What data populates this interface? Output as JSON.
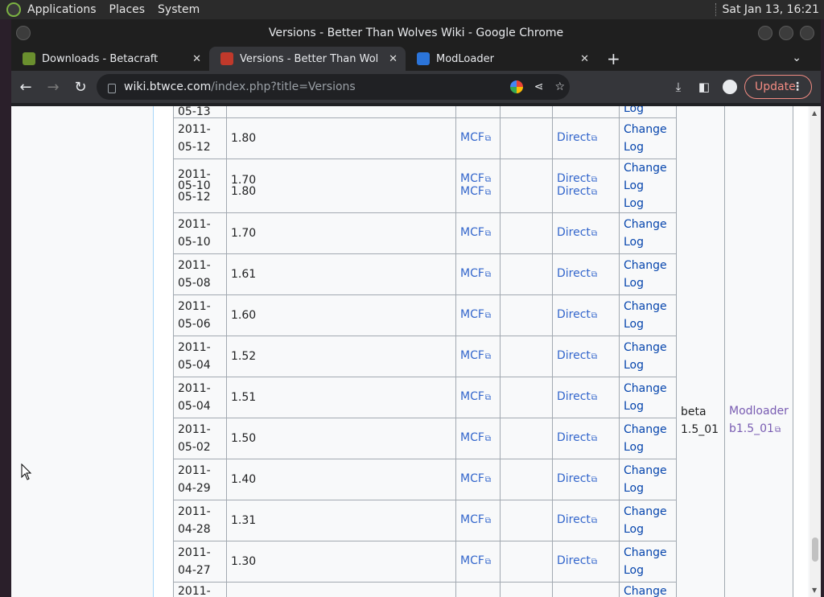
{
  "system_panel": {
    "menu": [
      "Applications",
      "Places",
      "System"
    ],
    "clock": "Sat Jan 13, 16:21"
  },
  "window": {
    "title": "Versions - Better Than Wolves Wiki - Google Chrome"
  },
  "tabs": [
    {
      "title": "Downloads - Betacraft",
      "active": false
    },
    {
      "title": "Versions - Better Than Wolve",
      "active": true
    },
    {
      "title": "ModLoader",
      "active": false
    }
  ],
  "toolbar": {
    "url_host": "wiki.btwce.com",
    "url_path": "/index.php?title=Versions",
    "update_label": "Update"
  },
  "table": {
    "top_partial_row": {
      "date": "05-13",
      "log": "Log"
    },
    "rows": [
      {
        "date": "2011-\n05-12",
        "version": "1.80",
        "mcf": "MCF",
        "direct": "Direct",
        "log": "Change\nLog"
      },
      {
        "date": "2011-\n05-10",
        "version": "1.70",
        "mcf": "MCF",
        "direct": "Direct",
        "log": "Change\nLog",
        "overlay": {
          "date": "05-12",
          "version": "1.80",
          "mcf": "MCF",
          "direct": "Direct",
          "log": "Log"
        }
      },
      {
        "date": "2011-\n05-10",
        "version": "1.70",
        "mcf": "MCF",
        "direct": "Direct",
        "log": "Change\nLog"
      },
      {
        "date": "2011-\n05-08",
        "version": "1.61",
        "mcf": "MCF",
        "direct": "Direct",
        "log": "Change\nLog"
      },
      {
        "date": "2011-\n05-06",
        "version": "1.60",
        "mcf": "MCF",
        "direct": "Direct",
        "log": "Change\nLog"
      },
      {
        "date": "2011-\n05-04",
        "version": "1.52",
        "mcf": "MCF",
        "direct": "Direct",
        "log": "Change\nLog"
      },
      {
        "date": "2011-\n05-04",
        "version": "1.51",
        "mcf": "MCF",
        "direct": "Direct",
        "log": "Change\nLog"
      },
      {
        "date": "2011-\n05-02",
        "version": "1.50",
        "mcf": "MCF",
        "direct": "Direct",
        "log": "Change\nLog"
      },
      {
        "date": "2011-\n04-29",
        "version": "1.40",
        "mcf": "MCF",
        "direct": "Direct",
        "log": "Change\nLog"
      },
      {
        "date": "2011-\n04-28",
        "version": "1.31",
        "mcf": "MCF",
        "direct": "Direct",
        "log": "Change\nLog"
      },
      {
        "date": "2011-\n04-27",
        "version": "1.30",
        "mcf": "MCF",
        "direct": "Direct",
        "log": "Change\nLog"
      },
      {
        "date": "2011-",
        "version": "",
        "mcf": "",
        "direct": "",
        "log": "Change"
      }
    ],
    "minecraft_version": "beta\n1.5_01",
    "modloader": "Modloader\nb1.5_01"
  }
}
